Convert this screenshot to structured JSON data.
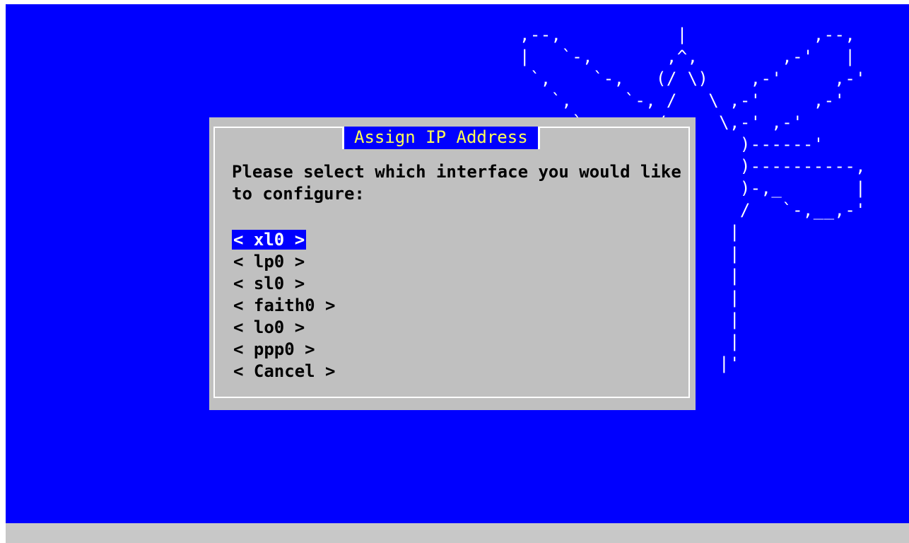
{
  "dialog": {
    "title": "Assign IP Address",
    "prompt": "Please select which interface you would like to configure:",
    "items": [
      {
        "label": "< xl0 >",
        "selected": true
      },
      {
        "label": "< lp0 >",
        "selected": false
      },
      {
        "label": "< sl0 >",
        "selected": false
      },
      {
        "label": "< faith0 >",
        "selected": false
      },
      {
        "label": "< lo0 >",
        "selected": false
      },
      {
        "label": "< ppp0 >",
        "selected": false
      },
      {
        "label": "< Cancel >",
        "selected": false
      }
    ]
  },
  "background_art": ",--,           |            ,--,\n|   `-,       ,^,        ,-'   |\n `,    `-,   (/ \\)    ,-'     ,-'\n   `,     `-, /   \\ ,-'     ,-'\n     `-,    ,/     \\,-' ,-'\n        `--'         )------'\n                     )----------,\n                     )-,_       |\n                     /   `-,__,-'\n                    |\n                    |\n                    |\n                    |\n                    |\n                    |\n                   |'",
  "colors": {
    "screen_background": "#0000ff",
    "dialog_background": "#c0c0c0",
    "title_text": "#ffff55",
    "selection_background": "#0000ff",
    "selection_text": "#ffffff",
    "bottom_bar": "#c8c8c8"
  }
}
